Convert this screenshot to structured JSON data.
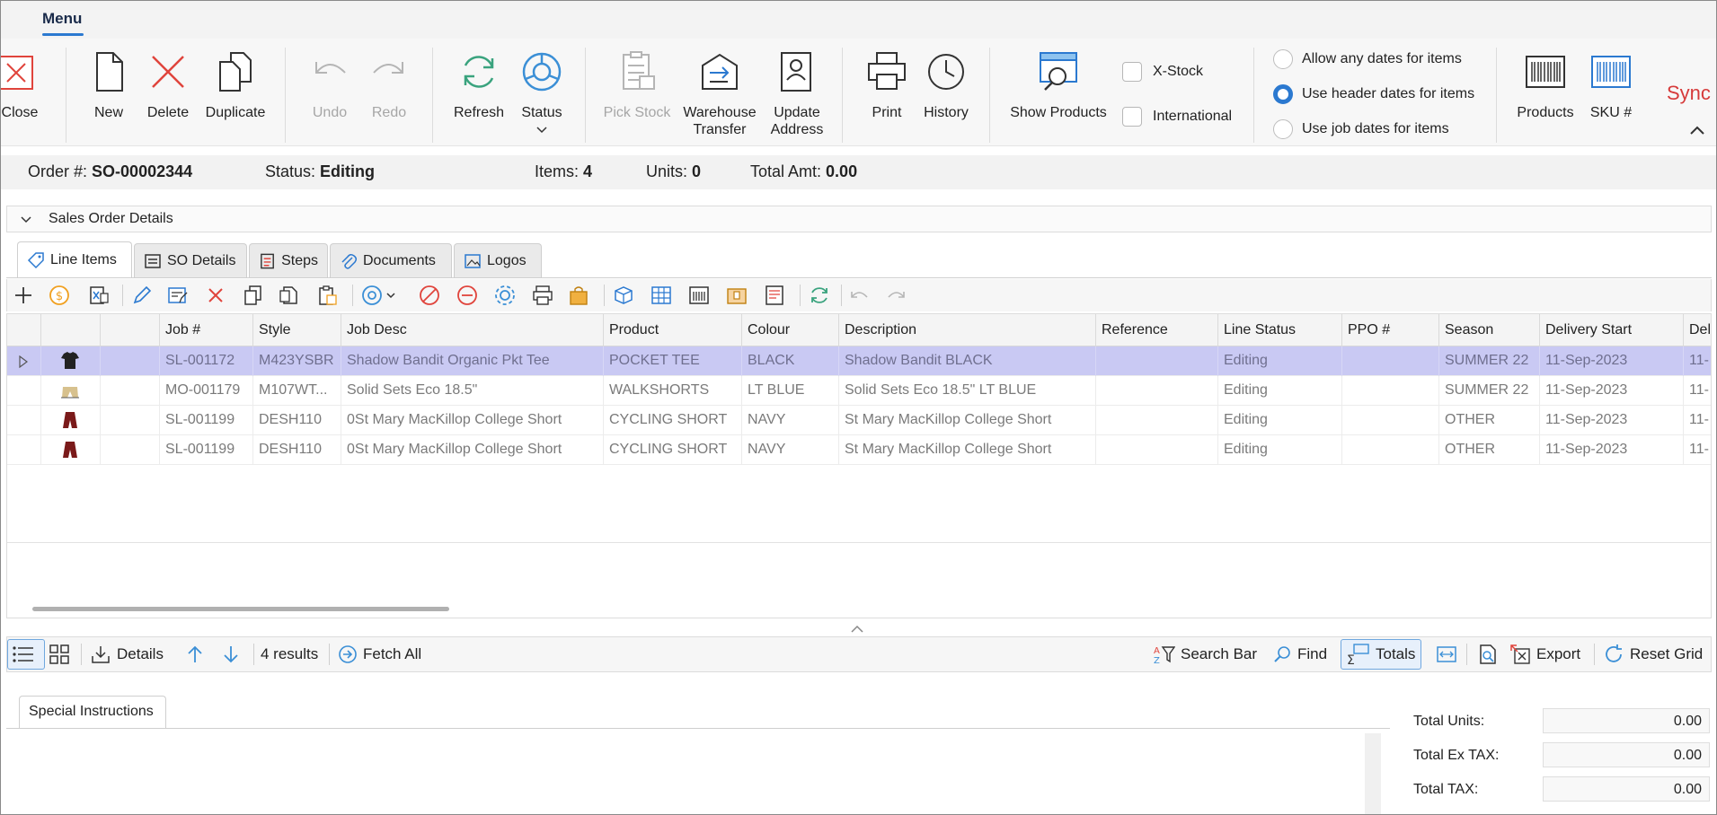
{
  "menu": {
    "tab_label": "Menu"
  },
  "ribbon": {
    "close": "Close",
    "new": "New",
    "delete": "Delete",
    "duplicate": "Duplicate",
    "undo": "Undo",
    "redo": "Redo",
    "refresh": "Refresh",
    "status": "Status",
    "pick_stock": "Pick Stock",
    "warehouse_transfer_1": "Warehouse",
    "warehouse_transfer_2": "Transfer",
    "update_address_1": "Update",
    "update_address_2": "Address",
    "print": "Print",
    "history": "History",
    "show_products": "Show Products",
    "x_stock": "X-Stock",
    "international": "International",
    "date_options": [
      "Allow any dates for items",
      "Use header dates for items",
      "Use job dates for items"
    ],
    "date_selected": "Use header dates for items",
    "products": "Products",
    "sku": "SKU #",
    "brand_partial": "Sync"
  },
  "order": {
    "order_label": "Order #:",
    "order_no": "SO-00002344",
    "status_label": "Status:",
    "status": "Editing",
    "items_label": "Items:",
    "items": "4",
    "units_label": "Units:",
    "units": "0",
    "total_label": "Total Amt:",
    "total": "0.00"
  },
  "section": {
    "title": "Sales Order Details"
  },
  "tabs": [
    "Line Items",
    "SO Details",
    "Steps",
    "Documents",
    "Logos"
  ],
  "grid": {
    "columns": [
      "Job #",
      "Style",
      "Job Desc",
      "Product",
      "Colour",
      "Description",
      "Reference",
      "Line Status",
      "PPO #",
      "Season",
      "Delivery Start",
      "Del"
    ],
    "rows": [
      {
        "job": "SL-001172",
        "style": "M423YSBR",
        "job_desc": "Shadow Bandit Organic Pkt Tee",
        "product": "POCKET TEE",
        "colour": "BLACK",
        "description": "Shadow Bandit  BLACK",
        "reference": "",
        "line_status": "Editing",
        "ppo": "",
        "season": "SUMMER 22",
        "delivery_start": "11-Sep-2023",
        "del": "11-",
        "icon": "tshirt-icon"
      },
      {
        "job": "MO-001179",
        "style": "M107WT...",
        "job_desc": "Solid Sets Eco 18.5\"",
        "product": "WALKSHORTS",
        "colour": "LT BLUE",
        "description": "Solid Sets Eco 18.5\" LT BLUE",
        "reference": "",
        "line_status": "Editing",
        "ppo": "",
        "season": "SUMMER 22",
        "delivery_start": "11-Sep-2023",
        "del": "11-",
        "icon": "shorts-icon"
      },
      {
        "job": "SL-001199",
        "style": "DESH110",
        "job_desc": "0St Mary MacKillop College Short",
        "product": "CYCLING SHORT",
        "colour": "NAVY",
        "description": "St Mary MacKillop College Short",
        "reference": "",
        "line_status": "Editing",
        "ppo": "",
        "season": "OTHER",
        "delivery_start": "11-Sep-2023",
        "del": "11-",
        "icon": "garment-icon"
      },
      {
        "job": "SL-001199",
        "style": "DESH110",
        "job_desc": "0St Mary MacKillop College Short",
        "product": "CYCLING SHORT",
        "colour": "NAVY",
        "description": "St Mary MacKillop College Short",
        "reference": "",
        "line_status": "Editing",
        "ppo": "",
        "season": "OTHER",
        "delivery_start": "11-Sep-2023",
        "del": "11-",
        "icon": "garment-icon"
      }
    ]
  },
  "bottombar": {
    "details": "Details",
    "results": "4 results",
    "fetch_all": "Fetch All",
    "search_bar": "Search Bar",
    "find": "Find",
    "totals": "Totals",
    "export": "Export",
    "reset_grid": "Reset Grid"
  },
  "special": {
    "tab": "Special Instructions"
  },
  "totals": {
    "units_label": "Total Units:",
    "units": "0.00",
    "ex_tax_label": "Total Ex TAX:",
    "ex_tax": "0.00",
    "tax_label": "Total TAX:",
    "tax": "0.00"
  },
  "colors": {
    "accent": "#2b79d0",
    "selected_row": "#c9c9f3",
    "delete_red": "#e0443c"
  }
}
